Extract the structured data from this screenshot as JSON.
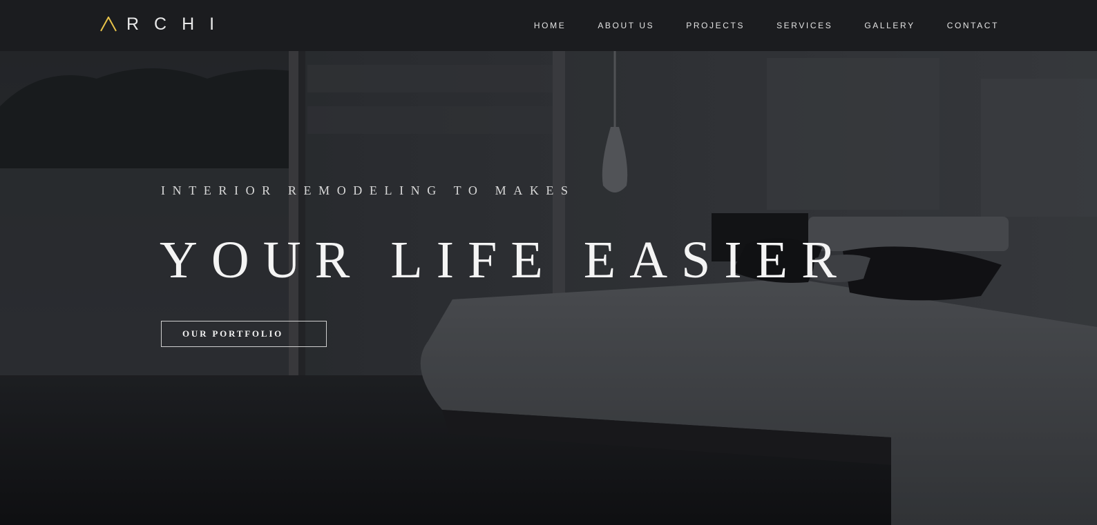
{
  "brand": {
    "logo_text": "RCHI",
    "logo_mark": "A",
    "accent_color": "#e8c34a"
  },
  "nav": {
    "items": [
      {
        "label": "HOME"
      },
      {
        "label": "ABOUT US"
      },
      {
        "label": "PROJECTS"
      },
      {
        "label": "SERVICES"
      },
      {
        "label": "GALLERY"
      },
      {
        "label": "CONTACT"
      }
    ]
  },
  "hero": {
    "subtitle": "INTERIOR REMODELING TO MAKES",
    "title": "YOUR LIFE EASIER",
    "button_label": "OUR PORTFOLIO",
    "background": "dark-bedroom-photo"
  }
}
